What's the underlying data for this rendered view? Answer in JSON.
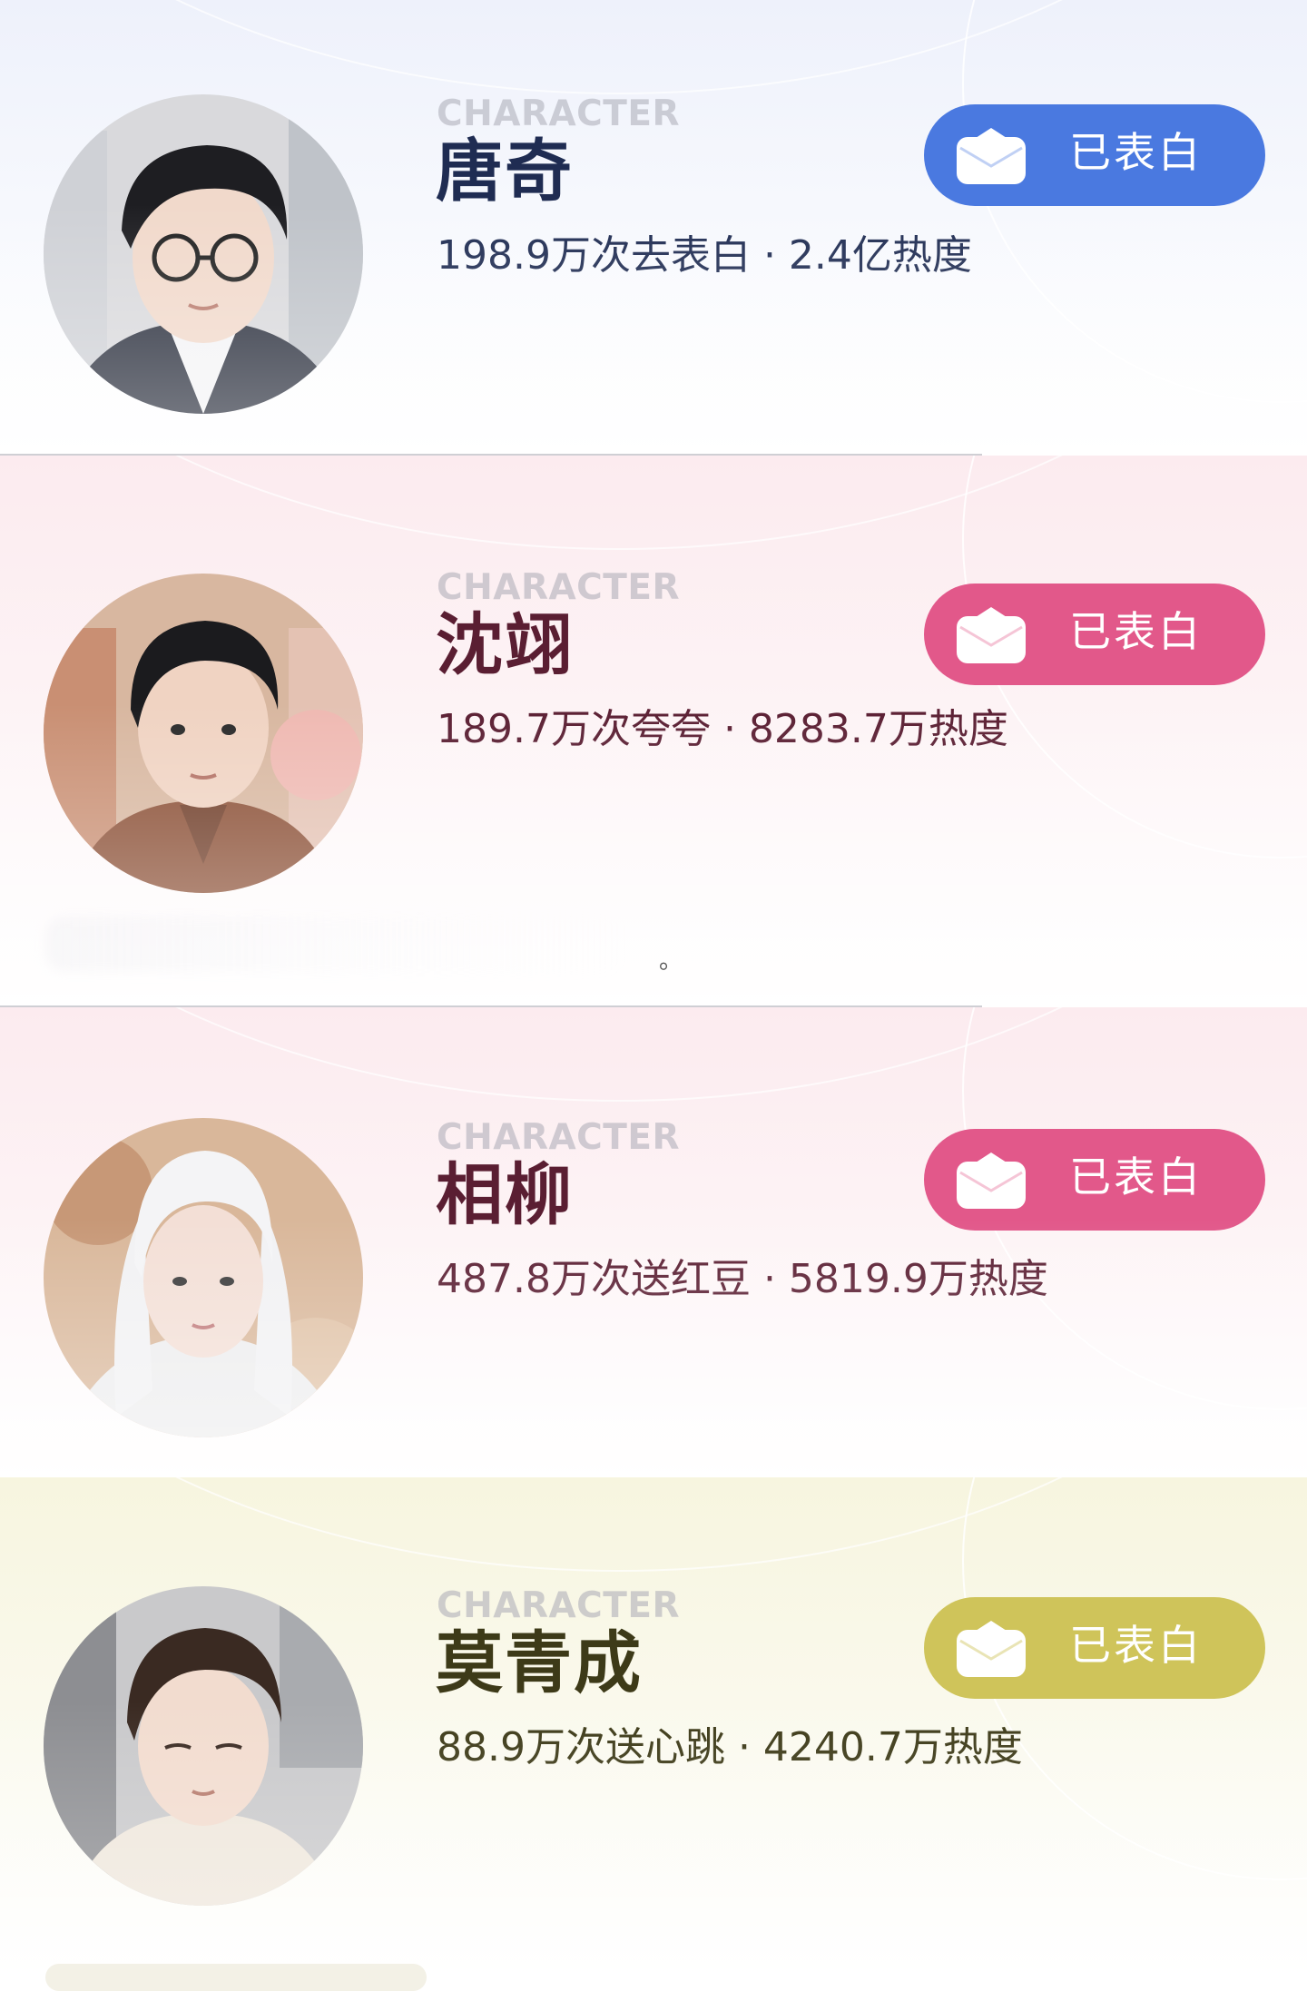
{
  "tag_label": "CHARACTER",
  "button_label": "已表白",
  "footer_mark": "。",
  "cards": [
    {
      "name": "唐奇",
      "stats": "198.9万次去表白 · 2.4亿热度",
      "theme": {
        "bg_top": "#eef1fb",
        "text": "#1f2c52",
        "button": "#4a79e0"
      },
      "avatar_icon": "portrait-glasses-icon"
    },
    {
      "name": "沈翊",
      "stats": "189.7万次夸夸 · 8283.7万热度",
      "theme": {
        "bg_top": "#fcebef",
        "text": "#5a1e32",
        "button": "#e2588a"
      },
      "avatar_icon": "portrait-brown-shirt-icon"
    },
    {
      "name": "相柳",
      "stats": "487.8万次送红豆 · 5819.9万热度",
      "theme": {
        "bg_top": "#fcebef",
        "text": "#5a1e32",
        "button": "#e2588a"
      },
      "avatar_icon": "portrait-white-hair-icon"
    },
    {
      "name": "莫青成",
      "stats": "88.9万次送心跳 · 4240.7万热度",
      "theme": {
        "bg_top": "#f7f5df",
        "text": "#3d3a18",
        "button": "#cfc45a"
      },
      "avatar_icon": "portrait-sweater-icon"
    }
  ]
}
